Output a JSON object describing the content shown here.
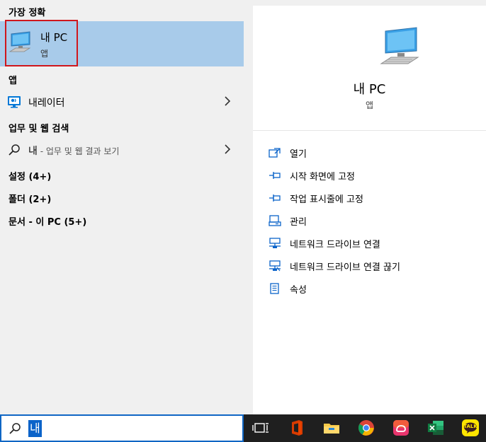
{
  "left": {
    "best_match_header": "가장 정확",
    "best_match": {
      "title": "내 PC",
      "subtitle": "앱",
      "icon": "this-pc-icon"
    },
    "apps_header": "앱",
    "apps": [
      {
        "label": "내레이터",
        "icon": "narrator-icon"
      }
    ],
    "web_header": "업무 및 웹 검색",
    "web_result": {
      "query": "내",
      "suffix": " - 업무 및 웹 결과 보기",
      "icon": "search-icon"
    },
    "categories": [
      "설정 (4+)",
      "폴더 (2+)",
      "문서 - 이 PC (5+)"
    ]
  },
  "right": {
    "title": "내 PC",
    "subtitle": "앱",
    "actions": [
      {
        "label": "열기",
        "icon": "open-icon"
      },
      {
        "label": "시작 화면에 고정",
        "icon": "pin-icon"
      },
      {
        "label": "작업 표시줄에 고정",
        "icon": "pin-icon"
      },
      {
        "label": "관리",
        "icon": "manage-icon"
      },
      {
        "label": "네트워크 드라이브 연결",
        "icon": "network-drive-icon"
      },
      {
        "label": "네트워크 드라이브 연결 끊기",
        "icon": "network-drive-disconnect-icon"
      },
      {
        "label": "속성",
        "icon": "properties-icon"
      }
    ]
  },
  "search": {
    "value": "내"
  },
  "taskbar": {
    "items": [
      "task-view-icon",
      "office-icon",
      "file-explorer-icon",
      "chrome-icon",
      "creative-cloud-icon",
      "excel-icon",
      "kakaotalk-icon"
    ],
    "kakao_text": "TALK"
  },
  "colors": {
    "selected_bg": "#a8cbea",
    "accent": "#0b63c9",
    "highlight_border": "#d0161c",
    "taskbar": "#1f1f1f"
  }
}
